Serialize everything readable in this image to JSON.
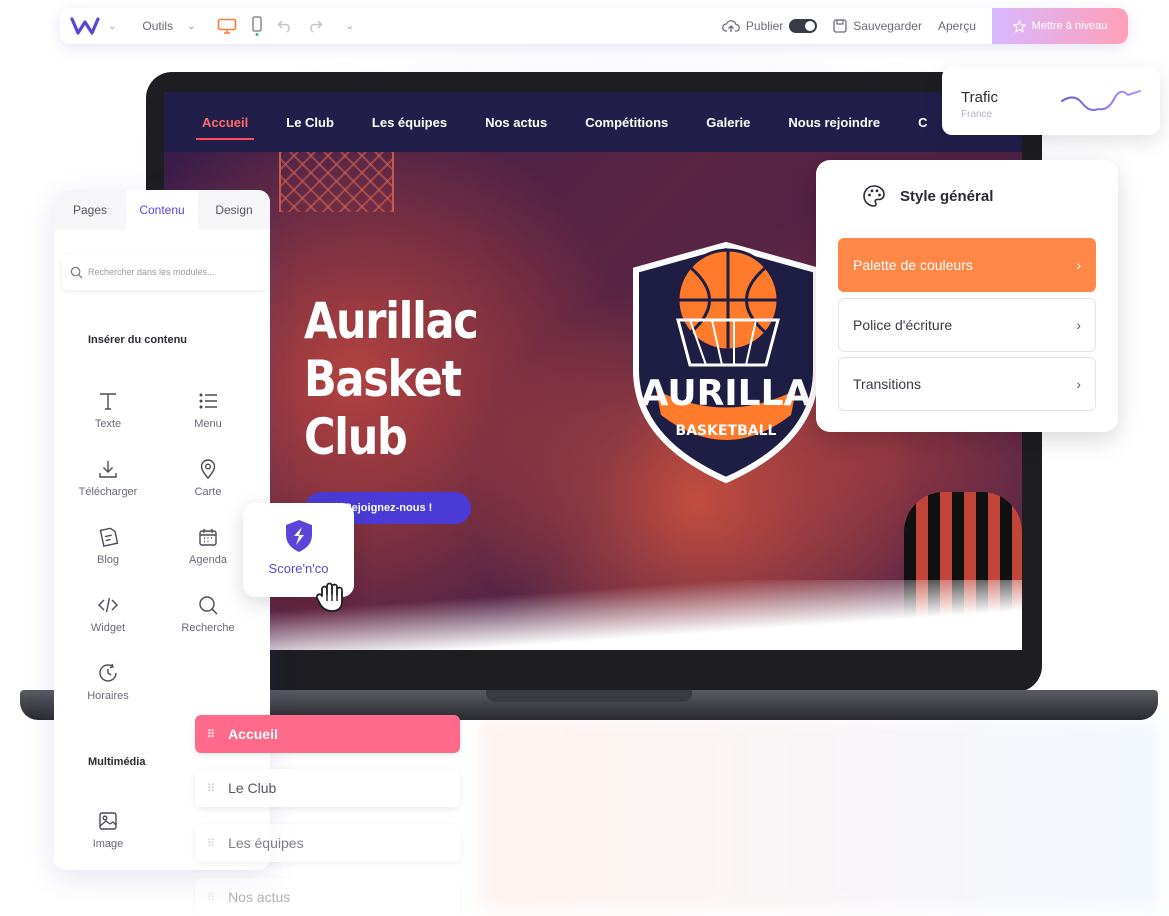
{
  "toolbar": {
    "tools_label": "Outils",
    "publish_label": "Publier",
    "save_label": "Sauvegarder",
    "preview_label": "Aperçu",
    "upgrade_label": "Mettre à niveau",
    "colors": {
      "accent": "#5b45d9",
      "device_active": "#ff7a3d"
    }
  },
  "site": {
    "nav": [
      "Accueil",
      "Le Club",
      "Les équipes",
      "Nos actus",
      "Compétitions",
      "Galerie",
      "Nous rejoindre",
      "C"
    ],
    "hero_title_line1": "Aurillac",
    "hero_title_line2": "Basket Club",
    "cta_label": "Rejoignez-nous !",
    "badge_name": "AURILLA",
    "badge_sub": "BASKETBALL"
  },
  "trafic": {
    "title": "Trafic",
    "subtitle": "France"
  },
  "style_panel": {
    "title": "Style général",
    "items": [
      {
        "label": "Palette de couleurs"
      },
      {
        "label": "Police d'écriture"
      },
      {
        "label": "Transitions"
      }
    ],
    "active_color": "#ff8747"
  },
  "left_panel": {
    "tabs": [
      "Pages",
      "Contenu",
      "Design"
    ],
    "search_placeholder": "Rechercher dans les modules...",
    "section_insert": "Insérer du contenu",
    "modules": [
      {
        "label": "Texte",
        "icon": "text-icon"
      },
      {
        "label": "Menu",
        "icon": "list-icon"
      },
      {
        "label": "Télécharger",
        "icon": "download-icon"
      },
      {
        "label": "Carte",
        "icon": "map-pin-icon"
      },
      {
        "label": "Blog",
        "icon": "blog-icon"
      },
      {
        "label": "Agenda",
        "icon": "calendar-icon"
      },
      {
        "label": "Widget",
        "icon": "code-icon"
      },
      {
        "label": "Recherche",
        "icon": "search-icon"
      },
      {
        "label": "Horaires",
        "icon": "clock-icon"
      }
    ],
    "section_media": "Multimédia",
    "media_modules": [
      {
        "label": "Image",
        "icon": "image-icon"
      }
    ]
  },
  "scoreco": {
    "label": "Score'n'co"
  },
  "pages": [
    "Accueil",
    "Le Club",
    "Les équipes",
    "Nos actus"
  ]
}
